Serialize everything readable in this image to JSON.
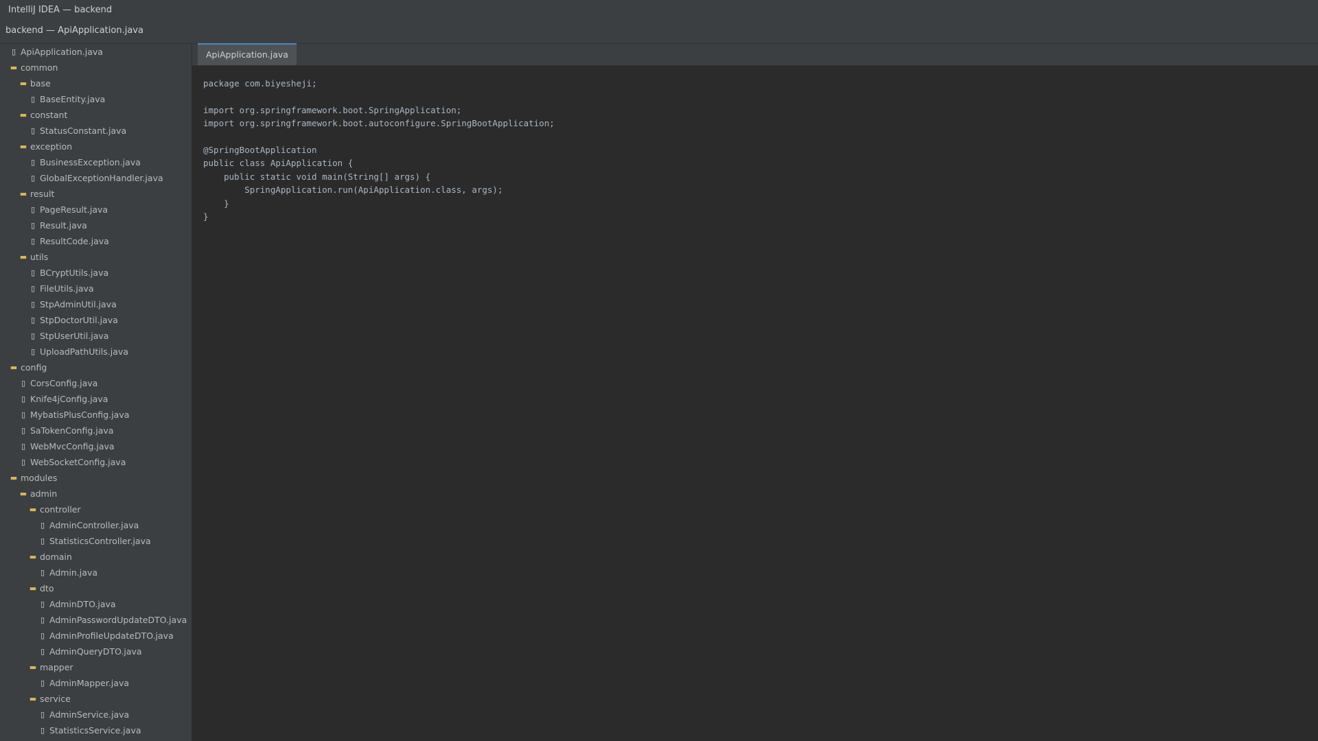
{
  "window": {
    "title": "IntelliJ IDEA — backend"
  },
  "navbar": {
    "path": "backend — ApiApplication.java"
  },
  "tree": [
    {
      "label": "ApiApplication.java",
      "depth": 0,
      "type": "file"
    },
    {
      "label": "common",
      "depth": 0,
      "type": "folder"
    },
    {
      "label": "base",
      "depth": 1,
      "type": "folder"
    },
    {
      "label": "BaseEntity.java",
      "depth": 2,
      "type": "file"
    },
    {
      "label": "constant",
      "depth": 1,
      "type": "folder"
    },
    {
      "label": "StatusConstant.java",
      "depth": 2,
      "type": "file"
    },
    {
      "label": "exception",
      "depth": 1,
      "type": "folder"
    },
    {
      "label": "BusinessException.java",
      "depth": 2,
      "type": "file"
    },
    {
      "label": "GlobalExceptionHandler.java",
      "depth": 2,
      "type": "file"
    },
    {
      "label": "result",
      "depth": 1,
      "type": "folder"
    },
    {
      "label": "PageResult.java",
      "depth": 2,
      "type": "file"
    },
    {
      "label": "Result.java",
      "depth": 2,
      "type": "file"
    },
    {
      "label": "ResultCode.java",
      "depth": 2,
      "type": "file"
    },
    {
      "label": "utils",
      "depth": 1,
      "type": "folder"
    },
    {
      "label": "BCryptUtils.java",
      "depth": 2,
      "type": "file"
    },
    {
      "label": "FileUtils.java",
      "depth": 2,
      "type": "file"
    },
    {
      "label": "StpAdminUtil.java",
      "depth": 2,
      "type": "file"
    },
    {
      "label": "StpDoctorUtil.java",
      "depth": 2,
      "type": "file"
    },
    {
      "label": "StpUserUtil.java",
      "depth": 2,
      "type": "file"
    },
    {
      "label": "UploadPathUtils.java",
      "depth": 2,
      "type": "file"
    },
    {
      "label": "config",
      "depth": 0,
      "type": "folder"
    },
    {
      "label": "CorsConfig.java",
      "depth": 1,
      "type": "file"
    },
    {
      "label": "Knife4jConfig.java",
      "depth": 1,
      "type": "file"
    },
    {
      "label": "MybatisPlusConfig.java",
      "depth": 1,
      "type": "file"
    },
    {
      "label": "SaTokenConfig.java",
      "depth": 1,
      "type": "file"
    },
    {
      "label": "WebMvcConfig.java",
      "depth": 1,
      "type": "file"
    },
    {
      "label": "WebSocketConfig.java",
      "depth": 1,
      "type": "file"
    },
    {
      "label": "modules",
      "depth": 0,
      "type": "folder"
    },
    {
      "label": "admin",
      "depth": 1,
      "type": "folder"
    },
    {
      "label": "controller",
      "depth": 2,
      "type": "folder"
    },
    {
      "label": "AdminController.java",
      "depth": 3,
      "type": "file"
    },
    {
      "label": "StatisticsController.java",
      "depth": 3,
      "type": "file"
    },
    {
      "label": "domain",
      "depth": 2,
      "type": "folder"
    },
    {
      "label": "Admin.java",
      "depth": 3,
      "type": "file"
    },
    {
      "label": "dto",
      "depth": 2,
      "type": "folder"
    },
    {
      "label": "AdminDTO.java",
      "depth": 3,
      "type": "file"
    },
    {
      "label": "AdminPasswordUpdateDTO.java",
      "depth": 3,
      "type": "file"
    },
    {
      "label": "AdminProfileUpdateDTO.java",
      "depth": 3,
      "type": "file"
    },
    {
      "label": "AdminQueryDTO.java",
      "depth": 3,
      "type": "file"
    },
    {
      "label": "mapper",
      "depth": 2,
      "type": "folder"
    },
    {
      "label": "AdminMapper.java",
      "depth": 3,
      "type": "file"
    },
    {
      "label": "service",
      "depth": 2,
      "type": "folder"
    },
    {
      "label": "AdminService.java",
      "depth": 3,
      "type": "file"
    },
    {
      "label": "StatisticsService.java",
      "depth": 3,
      "type": "file"
    }
  ],
  "editor": {
    "tabs": [
      {
        "label": "ApiApplication.java",
        "active": true
      }
    ],
    "code_lines": [
      "package com.biyesheji;",
      "",
      "import org.springframework.boot.SpringApplication;",
      "import org.springframework.boot.autoconfigure.SpringBootApplication;",
      "",
      "@SpringBootApplication",
      "public class ApiApplication {",
      "    public static void main(String[] args) {",
      "        SpringApplication.run(ApiApplication.class, args);",
      "    }",
      "}"
    ]
  },
  "icons": {
    "folder": "folder-icon",
    "file": "file-icon"
  },
  "colors": {
    "tab_accent": "#4a88c7",
    "folder": "#d8b65a"
  }
}
